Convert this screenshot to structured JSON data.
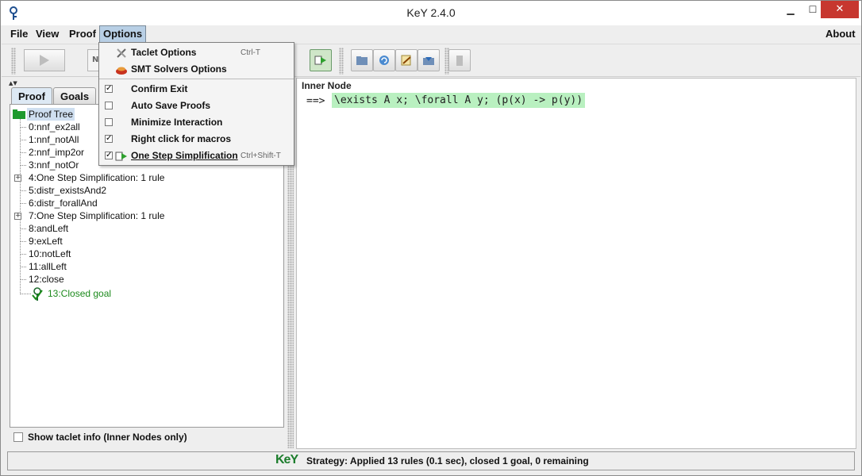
{
  "window": {
    "title": "KeY 2.4.0",
    "min_glyph": "▁",
    "max_glyph": "☐",
    "close_glyph": "✕"
  },
  "menubar": {
    "items": [
      "File",
      "View",
      "Proof",
      "Options"
    ],
    "about": "About"
  },
  "toolbar": {
    "field_text": "N"
  },
  "options_menu": {
    "items": [
      {
        "label": "Taclet Options",
        "accel": "Ctrl-T",
        "icon": "tools-icon"
      },
      {
        "label": "SMT Solvers Options",
        "accel": "",
        "icon": "smt-icon"
      },
      {
        "label": "Confirm Exit",
        "checked": true
      },
      {
        "label": "Auto Save Proofs",
        "checked": false
      },
      {
        "label": "Minimize Interaction",
        "checked": false
      },
      {
        "label": "Right click for macros",
        "checked": true
      },
      {
        "label": "One Step Simplification",
        "accel": "Ctrl+Shift-T",
        "checked": true,
        "icon": "simplify-icon"
      }
    ]
  },
  "left_panel": {
    "tabs": [
      "Proof",
      "Goals"
    ],
    "active_tab": "Proof",
    "tree": {
      "root": "Proof Tree",
      "nodes": [
        "0:nnf_ex2all",
        "1:nnf_notAll",
        "2:nnf_imp2or",
        "3:nnf_notOr",
        "4:One Step Simplification: 1 rule",
        "5:distr_existsAnd2",
        "6:distr_forallAnd",
        "7:One Step Simplification: 1 rule",
        "8:andLeft",
        "9:exLeft",
        "10:notLeft",
        "11:allLeft",
        "12:close"
      ],
      "closed_goal": "13:Closed goal"
    },
    "show_taclet_info": "Show taclet info (Inner Nodes only)"
  },
  "right_panel": {
    "title": "Inner Node",
    "sequent_arrow": "==>",
    "formula": "\\exists A x; \\forall A y; (p(x) -> p(y))"
  },
  "statusbar": {
    "logo": "KeY",
    "text": "Strategy: Applied 13 rules (0.1 sec), closed 1 goal, 0 remaining"
  },
  "colors": {
    "menu_highlight": "#b8cfe5",
    "formula_highlight": "#b9f0c0",
    "closed_goal": "#1c8a1c",
    "close_button": "#c7372f"
  }
}
